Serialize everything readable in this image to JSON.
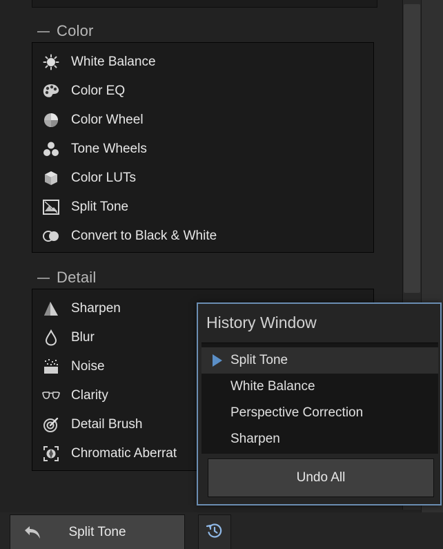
{
  "sections": {
    "color": {
      "title": "Color",
      "items": [
        {
          "label": "White Balance",
          "icon": "white-balance-icon"
        },
        {
          "label": "Color EQ",
          "icon": "color-eq-icon"
        },
        {
          "label": "Color Wheel",
          "icon": "color-wheel-icon"
        },
        {
          "label": "Tone Wheels",
          "icon": "tone-wheels-icon"
        },
        {
          "label": "Color LUTs",
          "icon": "color-luts-icon"
        },
        {
          "label": "Split Tone",
          "icon": "split-tone-icon"
        },
        {
          "label": "Convert to Black & White",
          "icon": "black-white-icon"
        }
      ]
    },
    "detail": {
      "title": "Detail",
      "items": [
        {
          "label": "Sharpen",
          "icon": "sharpen-icon"
        },
        {
          "label": "Blur",
          "icon": "blur-icon"
        },
        {
          "label": "Noise",
          "icon": "noise-icon"
        },
        {
          "label": "Clarity",
          "icon": "clarity-icon"
        },
        {
          "label": "Detail Brush",
          "icon": "detail-brush-icon"
        },
        {
          "label": "Chromatic Aberrat",
          "icon": "chromatic-aberration-icon"
        }
      ]
    }
  },
  "history": {
    "title": "History Window",
    "items": [
      {
        "label": "Split Tone",
        "selected": true
      },
      {
        "label": "White Balance",
        "selected": false
      },
      {
        "label": "Perspective Correction",
        "selected": false
      },
      {
        "label": "Sharpen",
        "selected": false
      }
    ],
    "undo_all_label": "Undo All"
  },
  "bottom_bar": {
    "current_edit_label": "Split Tone",
    "back_icon": "undo-arrow-icon",
    "history_icon": "history-icon"
  },
  "colors": {
    "background": "#222222",
    "panel": "#1b1b1b",
    "accent": "#5b8fc7",
    "text": "#e7e7e7"
  }
}
